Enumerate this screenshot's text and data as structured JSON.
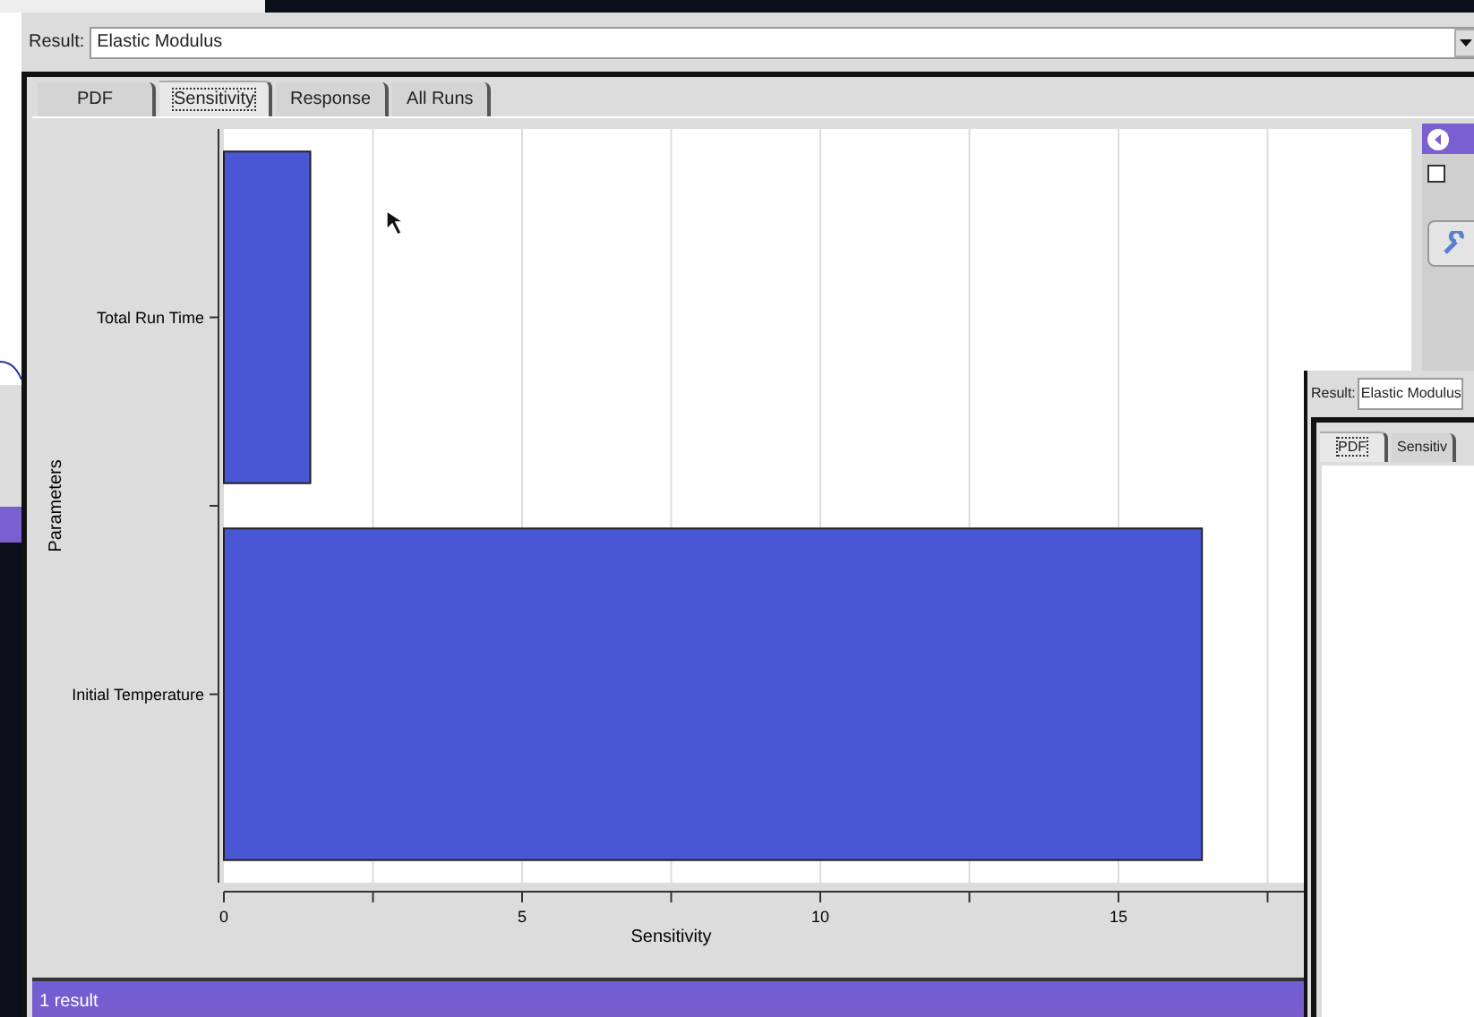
{
  "result_field": {
    "label": "Result:",
    "value": "Elastic Modulus"
  },
  "tabs": [
    {
      "label": "PDF",
      "selected": false
    },
    {
      "label": "Sensitivity",
      "selected": true
    },
    {
      "label": "Response",
      "selected": false
    },
    {
      "label": "All Runs",
      "selected": false
    }
  ],
  "chart_data": {
    "type": "bar",
    "orientation": "horizontal",
    "xlabel": "Sensitivity",
    "ylabel": "Parameters",
    "categories": [
      "Total Run Time",
      "Initial Temperature"
    ],
    "values": [
      1.45,
      16.4
    ],
    "xlim": [
      0,
      20
    ],
    "xticks": [
      0,
      5,
      10,
      15
    ],
    "grid": true
  },
  "side_panel": {
    "checkbox": {
      "checked": false
    }
  },
  "status_bar": {
    "text": "1 result"
  },
  "front_window": {
    "result_field": {
      "label": "Result:",
      "value": "Elastic Modulus"
    },
    "tabs": [
      {
        "label": "PDF",
        "selected": true
      },
      {
        "label": "Sensitiv",
        "selected": false
      }
    ]
  }
}
